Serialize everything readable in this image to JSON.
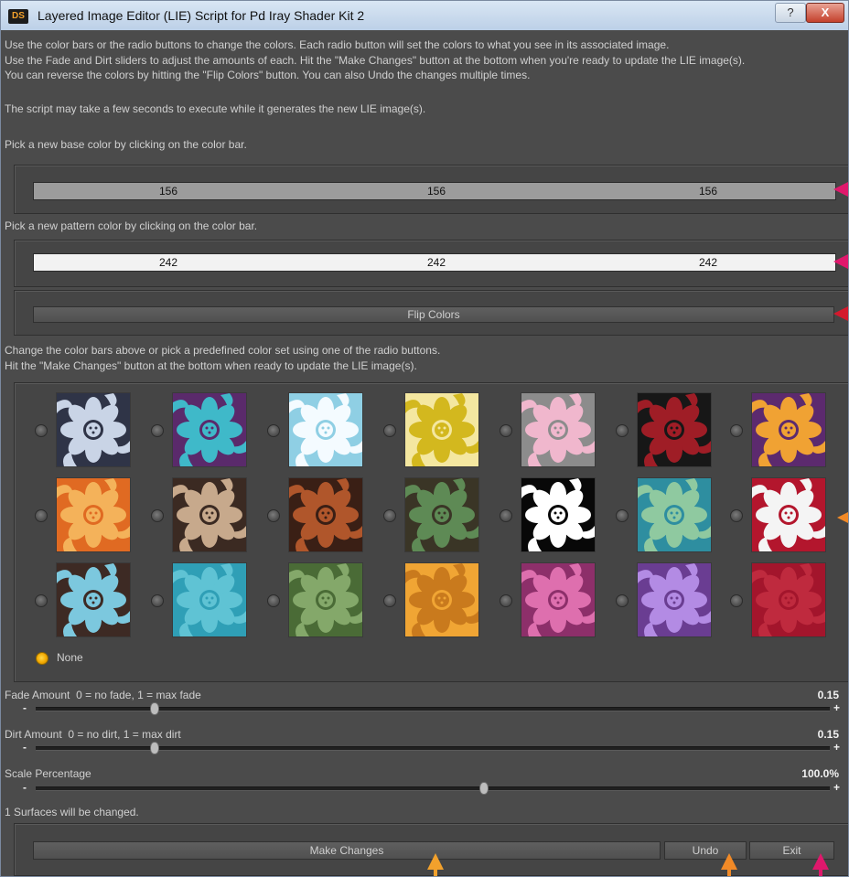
{
  "window": {
    "title": "Layered Image Editor (LIE) Script for Pd Iray Shader Kit 2",
    "app_icon_text": "DS",
    "help_label": "?",
    "close_label": "X"
  },
  "intro": {
    "lines": [
      "Use the color bars or the radio buttons to change the colors. Each radio button will set the colors to what you see in its associated image.",
      "Use the Fade and Dirt sliders to adjust the amounts of each. Hit the \"Make Changes\" button at the bottom when you're ready to update the LIE image(s).",
      "You can reverse the colors by hitting the \"Flip Colors\" button. You can also Undo the changes multiple times.",
      "The script may take a few seconds to execute while it generates the new LIE image(s)."
    ]
  },
  "base_color": {
    "label": "Pick a new base color by clicking on the color bar.",
    "r": "156",
    "g": "156",
    "b": "156",
    "color": "#9c9c9c"
  },
  "pattern_color": {
    "label": "Pick a new pattern color by clicking on the color bar.",
    "r": "242",
    "g": "242",
    "b": "242",
    "color": "#f2f2f2"
  },
  "flip_button": "Flip Colors",
  "presets": {
    "intro_line1": "Change the color bars above or pick a predefined color set using one of the radio buttons.",
    "intro_line2": "Hit the \"Make Changes\" button at the bottom when ready to update the LIE image(s).",
    "none_label": "None",
    "selected": "none",
    "swatches": [
      {
        "bg": "#2f3447",
        "fg": "#c9d4e6"
      },
      {
        "bg": "#5a2a6b",
        "fg": "#3fb9c9"
      },
      {
        "bg": "#8fcfe4",
        "fg": "#f4fbff"
      },
      {
        "bg": "#f4e7a0",
        "fg": "#d3b81e"
      },
      {
        "bg": "#8c8c8c",
        "fg": "#f0b7cd"
      },
      {
        "bg": "#171717",
        "fg": "#9f1d26"
      },
      {
        "bg": "#5c2a6e",
        "fg": "#f0a233"
      },
      {
        "bg": "#e06a22",
        "fg": "#f4b25a"
      },
      {
        "bg": "#3b2a22",
        "fg": "#c7a98c"
      },
      {
        "bg": "#3a1f15",
        "fg": "#b0562b"
      },
      {
        "bg": "#3a3526",
        "fg": "#5e8a55"
      },
      {
        "bg": "#080808",
        "fg": "#ffffff"
      },
      {
        "bg": "#2e8ea0",
        "fg": "#8fc9a0"
      },
      {
        "bg": "#b3162d",
        "fg": "#f4f4f4"
      },
      {
        "bg": "#3d2a24",
        "fg": "#7cc8de"
      },
      {
        "bg": "#2f9fb6",
        "fg": "#5fc3d4"
      },
      {
        "bg": "#4a6b36",
        "fg": "#84a86a"
      },
      {
        "bg": "#f0a534",
        "fg": "#c97a1d"
      },
      {
        "bg": "#8d2f6a",
        "fg": "#de6fae"
      },
      {
        "bg": "#6a3d92",
        "fg": "#b38be4"
      },
      {
        "bg": "#a3152c",
        "fg": "#bf2a3e"
      }
    ]
  },
  "fade": {
    "label": "Fade Amount",
    "hint": "0 = no fade, 1 = max fade",
    "value": "0.15",
    "fraction": 0.15
  },
  "dirt": {
    "label": "Dirt Amount",
    "hint": "0 = no dirt, 1 = max dirt",
    "value": "0.15",
    "fraction": 0.15
  },
  "scale": {
    "label": "Scale Percentage",
    "value": "100.0%",
    "fraction": 0.565
  },
  "minus_label": "-",
  "plus_label": "+",
  "status": "1 Surfaces will be changed.",
  "footer": {
    "make_changes": "Make Changes",
    "undo": "Undo",
    "exit": "Exit"
  },
  "colors": {
    "callout_magenta": "#e0186c",
    "callout_red": "#d4192d",
    "callout_orange": "#f28a27",
    "callout_amber": "#f2a12c"
  }
}
